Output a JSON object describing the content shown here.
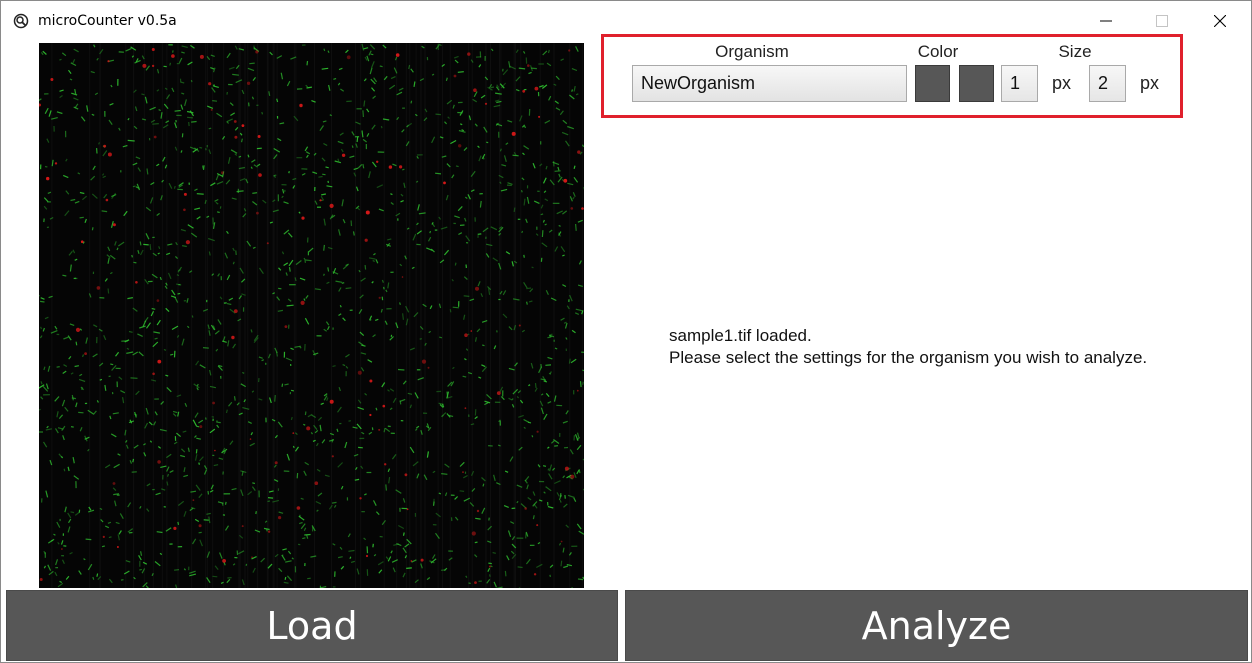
{
  "window": {
    "title": "microCounter v0.5a"
  },
  "settings": {
    "organism_label": "Organism",
    "color_label": "Color",
    "size_label": "Size",
    "organism_value": "NewOrganism",
    "color_swatches": [
      "#575757",
      "#575757"
    ],
    "size_min_value": "1",
    "size_min_unit": "px",
    "size_max_value": "2",
    "size_max_unit": "px",
    "highlight_color": "#e0202c"
  },
  "status": {
    "line1": "sample1.tif loaded.",
    "line2": "Please select the settings for the organism you wish to analyze."
  },
  "buttons": {
    "load": "Load",
    "analyze": "Analyze"
  },
  "colors": {
    "button_bg": "#575757",
    "image_bg": "#050505",
    "green_cells": "#2fbf2f",
    "red_cells": "#d41818"
  },
  "icons": {
    "app": "app-icon",
    "minimize": "minimize-icon",
    "maximize": "maximize-icon",
    "close": "close-icon"
  }
}
